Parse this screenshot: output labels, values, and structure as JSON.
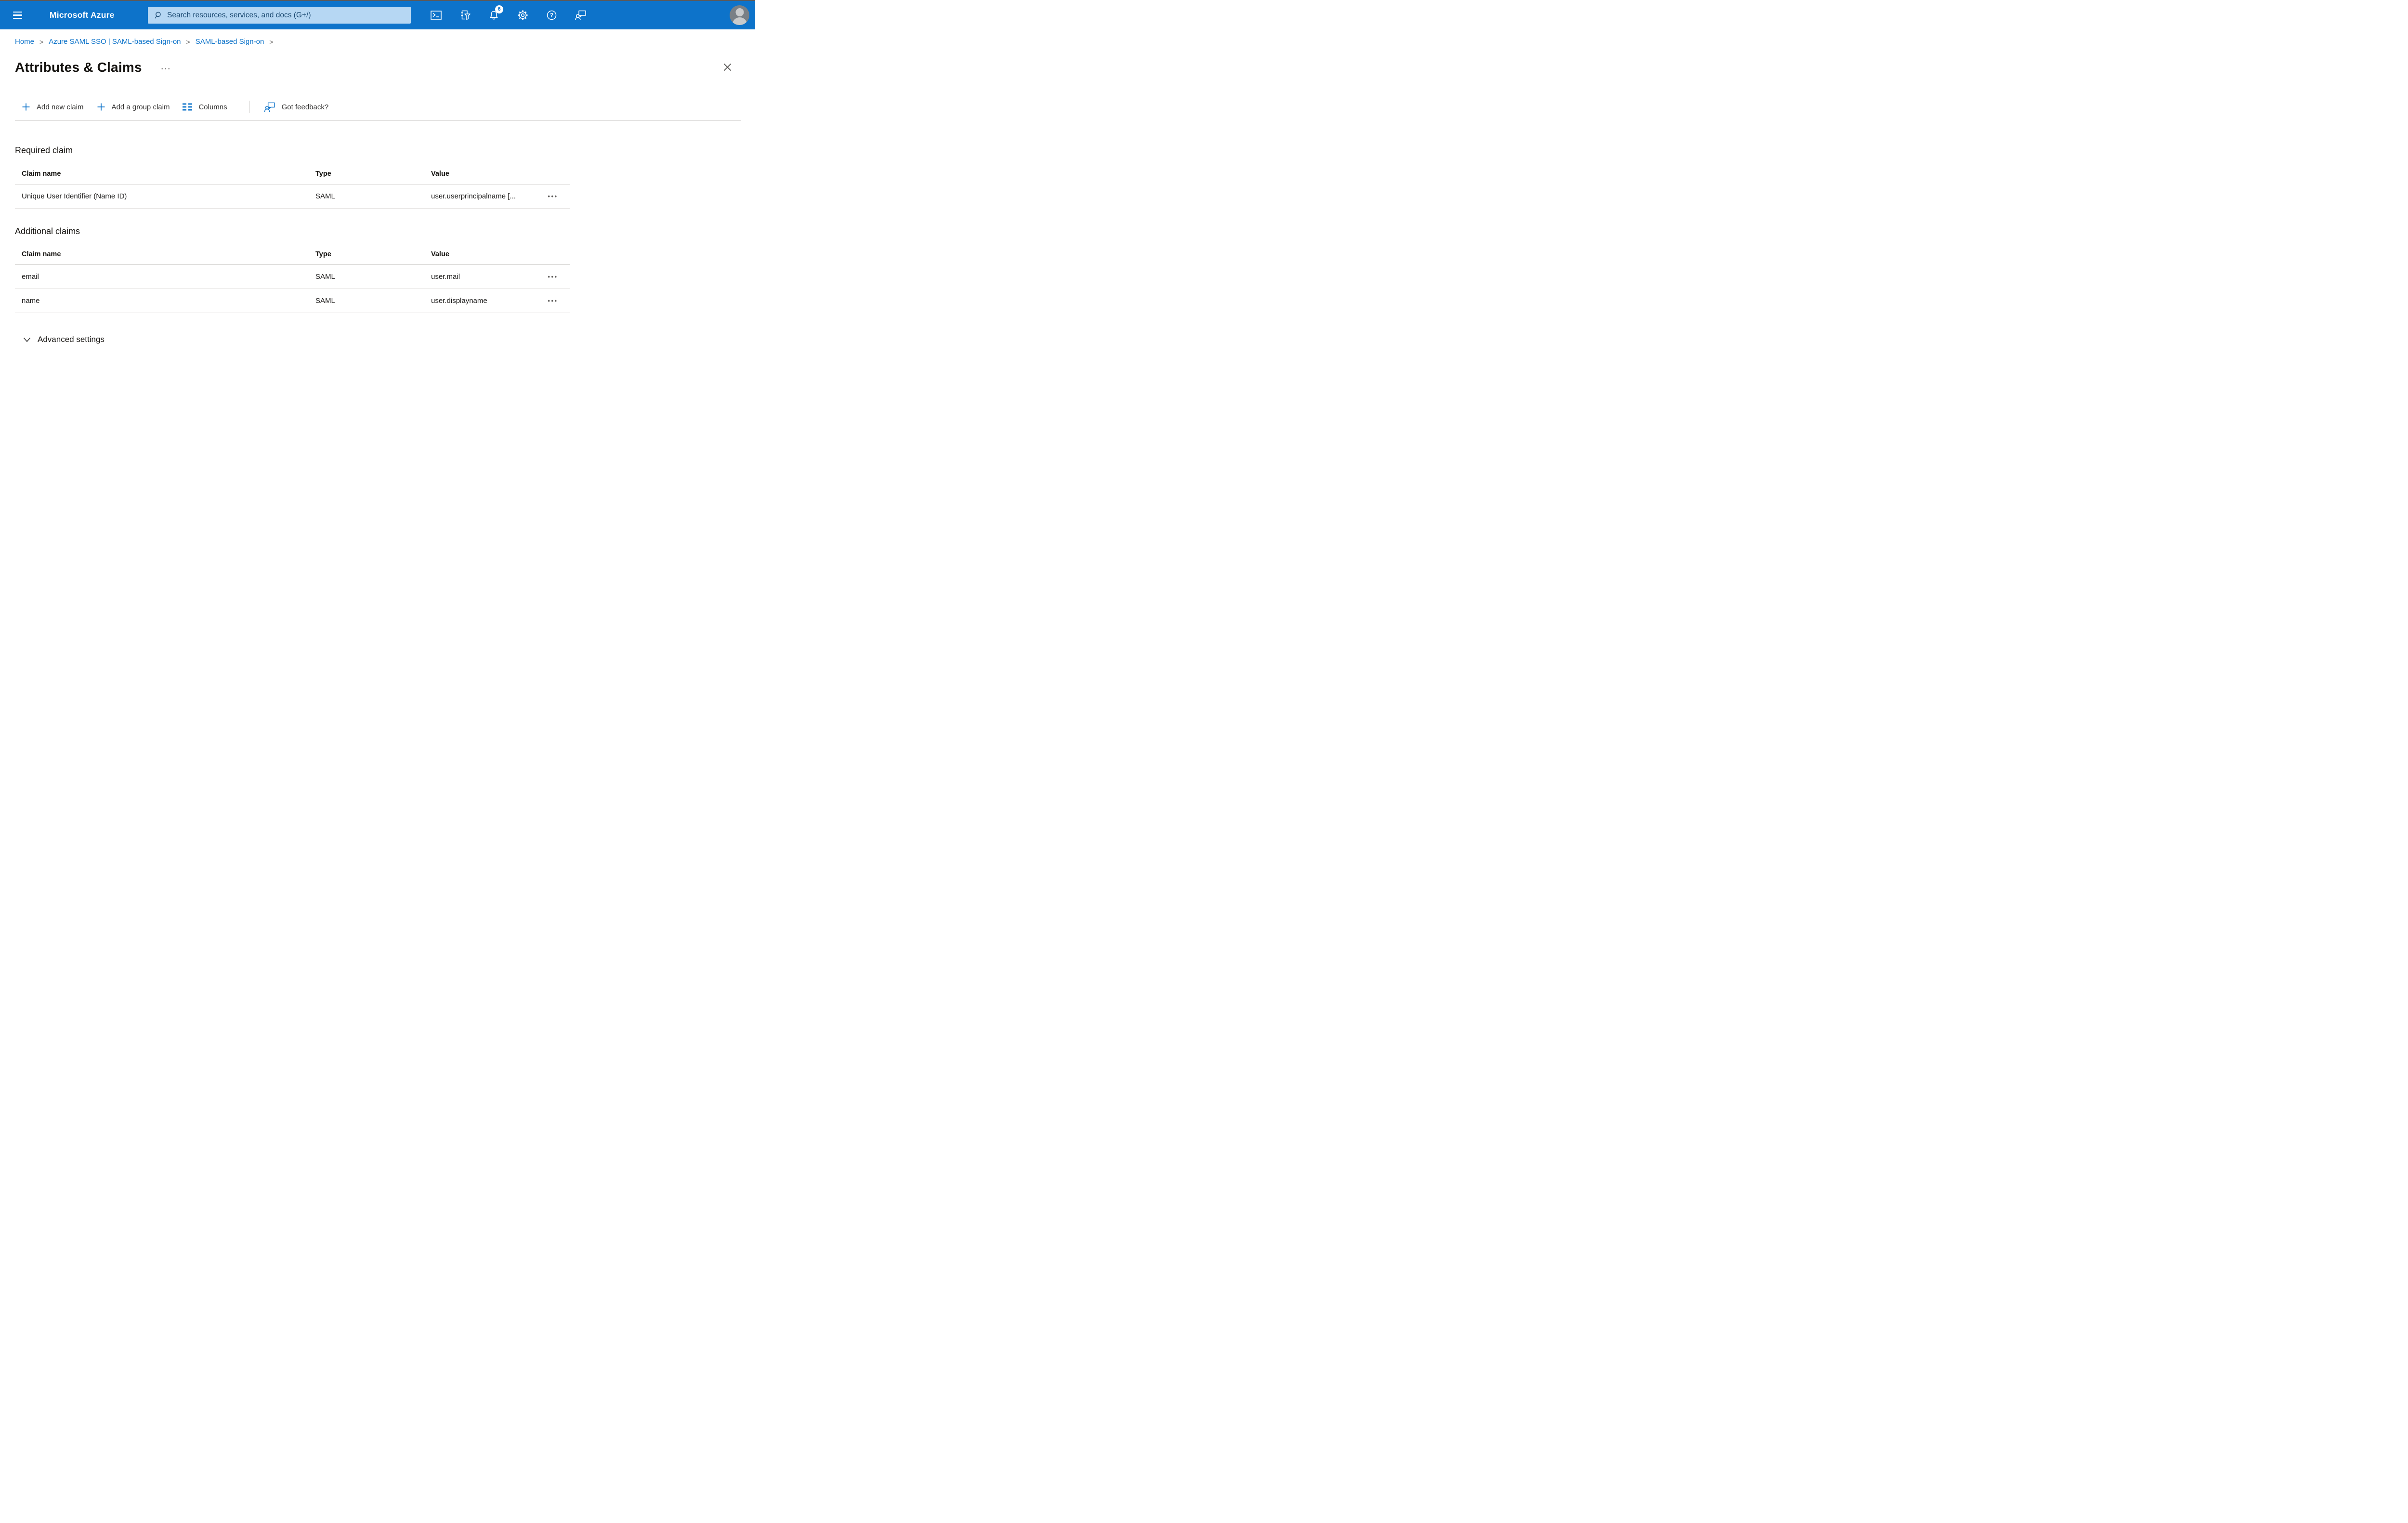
{
  "topbar": {
    "brand": "Microsoft Azure",
    "search_placeholder": "Search resources, services, and docs (G+/)",
    "notification_count": "6"
  },
  "breadcrumb": {
    "separator": ">",
    "items": [
      "Home",
      "Azure SAML SSO | SAML-based Sign-on",
      "SAML-based Sign-on"
    ]
  },
  "page": {
    "title": "Attributes & Claims",
    "title_menu": "···"
  },
  "toolbar": {
    "add_new_claim": "Add new claim",
    "add_group_claim": "Add a group claim",
    "columns": "Columns",
    "got_feedback": "Got feedback?"
  },
  "tables": {
    "required": {
      "heading": "Required claim",
      "columns": [
        "Claim name",
        "Type",
        "Value"
      ],
      "rows": [
        {
          "claim_name": "Unique User Identifier (Name ID)",
          "type": "SAML",
          "value": "user.userprincipalname [...",
          "menu": "•••"
        }
      ]
    },
    "additional": {
      "heading": "Additional claims",
      "columns": [
        "Claim name",
        "Type",
        "Value"
      ],
      "rows": [
        {
          "claim_name": "email",
          "type": "SAML",
          "value": "user.mail",
          "menu": "•••"
        },
        {
          "claim_name": "name",
          "type": "SAML",
          "value": "user.displayname",
          "menu": "•••"
        }
      ]
    }
  },
  "advanced": {
    "label": "Advanced settings"
  },
  "colors": {
    "topbar_blue": "#0d73ca",
    "link_blue": "#0b72c9",
    "search_bg": "#b6d7f3",
    "search_text": "#1b4a72"
  }
}
